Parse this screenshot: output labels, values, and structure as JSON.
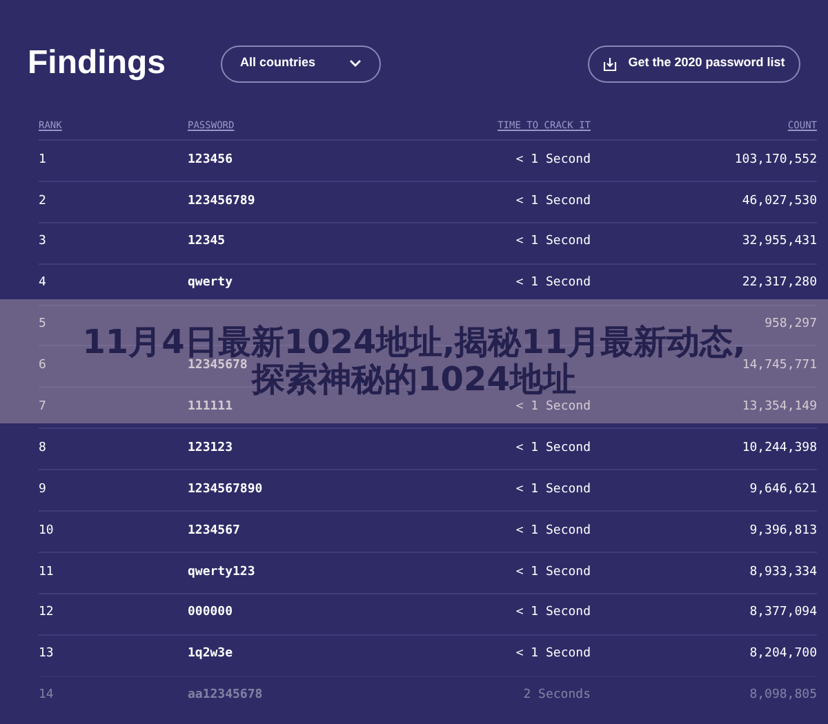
{
  "title": "Findings",
  "country_select": {
    "value": "All countries"
  },
  "download_button": {
    "label": "Get the 2020 password list"
  },
  "table": {
    "columns": [
      "RANK",
      "PASSWORD",
      "TIME TO CRACK IT",
      "COUNT"
    ],
    "rows": [
      {
        "rank": "1",
        "password": "123456",
        "time": "< 1 Second",
        "count": "103,170,552",
        "faded": false
      },
      {
        "rank": "2",
        "password": "123456789",
        "time": "< 1 Second",
        "count": "46,027,530",
        "faded": false
      },
      {
        "rank": "3",
        "password": "12345",
        "time": "< 1 Second",
        "count": "32,955,431",
        "faded": false
      },
      {
        "rank": "4",
        "password": "qwerty",
        "time": "< 1 Second",
        "count": "22,317,280",
        "faded": false
      },
      {
        "rank": "5",
        "count": "958,297",
        "faded": false
      },
      {
        "rank": "6",
        "password": "12345678",
        "count": "14,745,771",
        "faded": false
      },
      {
        "rank": "7",
        "password": "111111",
        "time": "< 1 Second",
        "count": "13,354,149",
        "faded": false
      },
      {
        "rank": "8",
        "password": "123123",
        "time": "< 1 Second",
        "count": "10,244,398",
        "faded": false
      },
      {
        "rank": "9",
        "password": "1234567890",
        "time": "< 1 Second",
        "count": "9,646,621",
        "faded": false
      },
      {
        "rank": "10",
        "password": "1234567",
        "time": "< 1 Second",
        "count": "9,396,813",
        "faded": false
      },
      {
        "rank": "11",
        "password": "qwerty123",
        "time": "< 1 Second",
        "count": "8,933,334",
        "faded": false
      },
      {
        "rank": "12",
        "password": "000000",
        "time": "< 1 Second",
        "count": "8,377,094",
        "faded": false
      },
      {
        "rank": "13",
        "password": "1q2w3e",
        "time": "< 1 Second",
        "count": "8,204,700",
        "faded": false
      },
      {
        "rank": "14",
        "password": "aa12345678",
        "time": "2 Seconds",
        "count": "8,098,805",
        "faded": true
      }
    ]
  },
  "overlay_title": {
    "lines": [
      "11月4日最新1024地址,揭秘11月最新动态,",
      "探索神秘的1024地址"
    ]
  }
}
